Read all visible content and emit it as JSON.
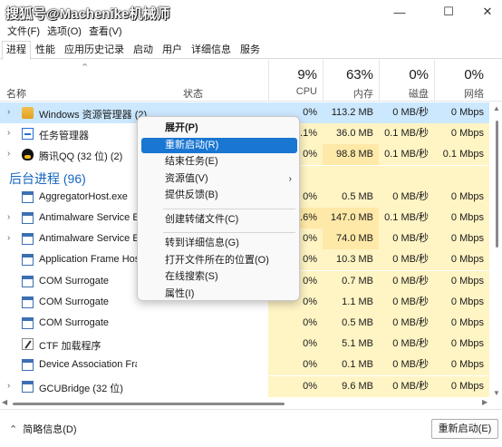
{
  "watermark": "搜狐号@Machenike机械师",
  "window_controls": {
    "minimize": "—",
    "maximize": "☐",
    "close": "✕"
  },
  "menu": [
    "文件(F)",
    "选项(O)",
    "查看(V)"
  ],
  "tabs": [
    "进程",
    "性能",
    "应用历史记录",
    "启动",
    "用户",
    "详细信息",
    "服务"
  ],
  "columns": {
    "name": "名称",
    "status": "状态",
    "cpu": {
      "pct": "9%",
      "label": "CPU"
    },
    "memory": {
      "pct": "63%",
      "label": "内存"
    },
    "disk": {
      "pct": "0%",
      "label": "磁盘"
    },
    "network": {
      "pct": "0%",
      "label": "网络"
    }
  },
  "rows": [
    {
      "kind": "proc",
      "name": "Windows 资源管理器 (2)",
      "icon": "folder-icon",
      "expand": true,
      "cpu": "0%",
      "mem": "113.2 MB",
      "disk": "0 MB/秒",
      "net": "0 Mbps",
      "selected": true
    },
    {
      "kind": "proc",
      "name": "任务管理器",
      "icon": "task-manager-icon",
      "expand": true,
      "cpu": "0.1%",
      "mem": "36.0 MB",
      "disk": "0.1 MB/秒",
      "net": "0 Mbps"
    },
    {
      "kind": "proc",
      "name": "腾讯QQ (32 位) (2)",
      "icon": "qq-penguin-icon",
      "expand": true,
      "cpu": "0%",
      "mem": "98.8 MB",
      "disk": "0.1 MB/秒",
      "net": "0.1 Mbps"
    },
    {
      "kind": "section",
      "name": "后台进程 (96)"
    },
    {
      "kind": "proc",
      "name": "AggregatorHost.exe",
      "icon": "app-window-icon",
      "expand": false,
      "cpu": "0%",
      "mem": "0.5 MB",
      "disk": "0 MB/秒",
      "net": "0 Mbps"
    },
    {
      "kind": "proc",
      "name": "Antimalware Service Executable",
      "icon": "app-window-icon",
      "expand": true,
      "cpu": "0.6%",
      "mem": "147.0 MB",
      "disk": "0.1 MB/秒",
      "net": "0 Mbps"
    },
    {
      "kind": "proc",
      "name": "Antimalware Service Executable Content Process",
      "icon": "app-window-icon",
      "expand": true,
      "cpu": "0%",
      "mem": "74.0 MB",
      "disk": "0 MB/秒",
      "net": "0 Mbps"
    },
    {
      "kind": "proc",
      "name": "Application Frame Host",
      "icon": "app-window-icon",
      "expand": false,
      "cpu": "0%",
      "mem": "10.3 MB",
      "disk": "0 MB/秒",
      "net": "0 Mbps"
    },
    {
      "kind": "proc",
      "name": "COM Surrogate",
      "icon": "app-window-icon",
      "expand": false,
      "cpu": "0%",
      "mem": "0.7 MB",
      "disk": "0 MB/秒",
      "net": "0 Mbps"
    },
    {
      "kind": "proc",
      "name": "COM Surrogate",
      "icon": "app-window-icon",
      "expand": false,
      "cpu": "0%",
      "mem": "1.1 MB",
      "disk": "0 MB/秒",
      "net": "0 Mbps"
    },
    {
      "kind": "proc",
      "name": "COM Surrogate",
      "icon": "app-window-icon",
      "expand": false,
      "cpu": "0%",
      "mem": "0.5 MB",
      "disk": "0 MB/秒",
      "net": "0 Mbps"
    },
    {
      "kind": "proc",
      "name": "CTF 加载程序",
      "icon": "pen-icon",
      "expand": false,
      "cpu": "0%",
      "mem": "5.1 MB",
      "disk": "0 MB/秒",
      "net": "0 Mbps"
    },
    {
      "kind": "proc",
      "name": "Device Association Framework Provider Host",
      "icon": "app-window-icon",
      "expand": false,
      "cpu": "0%",
      "mem": "0.1 MB",
      "disk": "0 MB/秒",
      "net": "0 Mbps"
    },
    {
      "kind": "proc",
      "name": "GCUBridge (32 位)",
      "icon": "app-window-icon",
      "expand": true,
      "cpu": "0%",
      "mem": "9.6 MB",
      "disk": "0 MB/秒",
      "net": "0 Mbps"
    }
  ],
  "context_menu": [
    {
      "label": "展开(P)",
      "bold": true
    },
    {
      "label": "重新启动(R)",
      "highlight": true
    },
    {
      "label": "结束任务(E)"
    },
    {
      "label": "资源值(V)",
      "submenu": true
    },
    {
      "label": "提供反馈(B)"
    },
    {
      "separator": true
    },
    {
      "label": "创建转储文件(C)"
    },
    {
      "separator": true
    },
    {
      "label": "转到详细信息(G)"
    },
    {
      "label": "打开文件所在的位置(O)"
    },
    {
      "label": "在线搜索(S)"
    },
    {
      "label": "属性(I)"
    }
  ],
  "footer": {
    "fewer_details": "简略信息(D)",
    "restart_button": "重新启动(E)"
  }
}
